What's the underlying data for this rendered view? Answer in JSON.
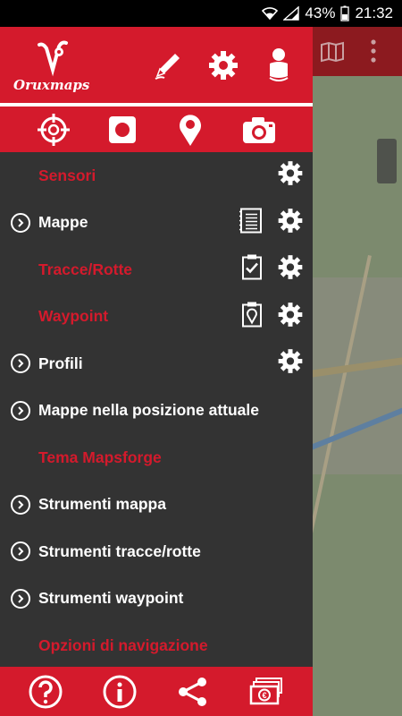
{
  "status_bar": {
    "battery": "43%",
    "time": "21:32"
  },
  "brand": {
    "logo_text_1": "Oruxmaps"
  },
  "menu": {
    "items": [
      {
        "label": "Sensori",
        "section": true
      },
      {
        "label": "Mappe",
        "section": false
      },
      {
        "label": "Tracce/Rotte",
        "section": true
      },
      {
        "label": "Waypoint",
        "section": true
      },
      {
        "label": "Profili",
        "section": false
      },
      {
        "label": "Mappe nella posizione attuale",
        "section": false
      },
      {
        "label": "Tema Mapsforge",
        "section": true
      },
      {
        "label": "Strumenti mappa",
        "section": false
      },
      {
        "label": "Strumenti tracce/rotte",
        "section": false
      },
      {
        "label": "Strumenti waypoint",
        "section": false
      },
      {
        "label": "Opzioni di navigazione",
        "section": true
      }
    ]
  },
  "icons": {
    "header": [
      "pen-icon",
      "gear-icon",
      "user-icon"
    ],
    "quickbar": [
      "target-icon",
      "record-icon",
      "waypoint-pin-icon",
      "camera-icon"
    ],
    "bottombar": [
      "help-icon",
      "info-icon",
      "share-icon",
      "donate-icon"
    ]
  },
  "colors": {
    "accent": "#d41a2c",
    "drawer_bg": "#333333",
    "map_bar": "#8c1a1f"
  }
}
